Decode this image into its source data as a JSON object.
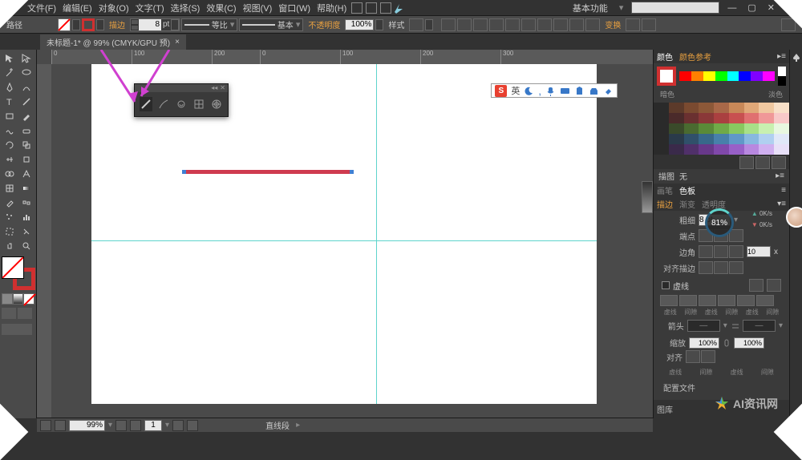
{
  "menu": {
    "items": [
      "文件(F)",
      "编辑(E)",
      "对象(O)",
      "文字(T)",
      "选择(S)",
      "效果(C)",
      "视图(V)",
      "窗口(W)",
      "帮助(H)"
    ],
    "workspace": "基本功能"
  },
  "control": {
    "path_label": "路径",
    "stroke_label": "描边",
    "stroke_width": "8",
    "stroke_unit": "pt",
    "profile_uniform": "等比",
    "profile_basic": "基本",
    "opacity_label": "不透明度",
    "opacity_value": "100%",
    "style_label": "样式",
    "transform_label": "变换"
  },
  "tab": {
    "title": "未标题-1* @ 99% (CMYK/GPU 预)"
  },
  "ruler": {
    "marks": [
      "0",
      "100",
      "200",
      "0",
      "100",
      "200",
      "300"
    ]
  },
  "ime": {
    "lang": "英"
  },
  "panels": {
    "color": {
      "tab1": "颜色",
      "tab2": "颜色参考",
      "dark": "暗色",
      "light": "淡色"
    },
    "stroke_info": {
      "label1": "描图",
      "label2": "无"
    },
    "brushes": {
      "tab1": "画笔",
      "tab2": "色板"
    },
    "stroke": {
      "tab1": "描边",
      "tab2": "渐变",
      "tab3": "透明度",
      "weight_label": "粗细",
      "weight_value": "8 pt",
      "cap_label": "端点",
      "corner_label": "边角",
      "corner_limit": "10",
      "align_label": "对齐描边",
      "dash_label": "虚线",
      "dash_cols": [
        "虚线",
        "间隙",
        "虚线",
        "间隙",
        "虚线",
        "间隙"
      ],
      "arrow_label": "箭头",
      "scale_label": "缩放",
      "scale_val": "100%",
      "align2_label": "对齐",
      "bottom_cols": [
        "虚线",
        "间隙",
        "虚线",
        "间隙"
      ],
      "profile_label": "配置文件"
    },
    "detail_speed": "0K/s",
    "percent": "81%",
    "x_label": "x",
    "lib_label": "图库"
  },
  "status": {
    "zoom": "99%",
    "page": "1",
    "selection": "直线段"
  },
  "watermark": "AI资讯网",
  "swatches": {
    "hue": [
      "#ff0000",
      "#ff8000",
      "#ffff00",
      "#00ff00",
      "#00ffff",
      "#0000ff",
      "#8000ff",
      "#ff00ff"
    ],
    "rows": [
      [
        "#2a2a2a",
        "#5c3a2a",
        "#7a4a30",
        "#8c5838",
        "#a86848",
        "#c88858",
        "#e0a878",
        "#f0c8a0",
        "#f8e0c8"
      ],
      [
        "#2a2a2a",
        "#4a2a2a",
        "#6a3030",
        "#8a3838",
        "#aa4040",
        "#c85050",
        "#e07070",
        "#f09898",
        "#f8c8c8"
      ],
      [
        "#2a2a2a",
        "#3a4a2a",
        "#4a6a30",
        "#5a8a38",
        "#70aa48",
        "#88c860",
        "#a8e088",
        "#c8f0b0",
        "#e8f8e0"
      ],
      [
        "#2a2a2a",
        "#2a3a4a",
        "#30506a",
        "#38688a",
        "#4880aa",
        "#6098c8",
        "#88b8e0",
        "#b0d0f0",
        "#e0e8f8"
      ],
      [
        "#2a2a2a",
        "#3a2a4a",
        "#50306a",
        "#68388a",
        "#8048aa",
        "#9860c8",
        "#b888e0",
        "#d0b0f0",
        "#e8e0f8"
      ]
    ]
  }
}
